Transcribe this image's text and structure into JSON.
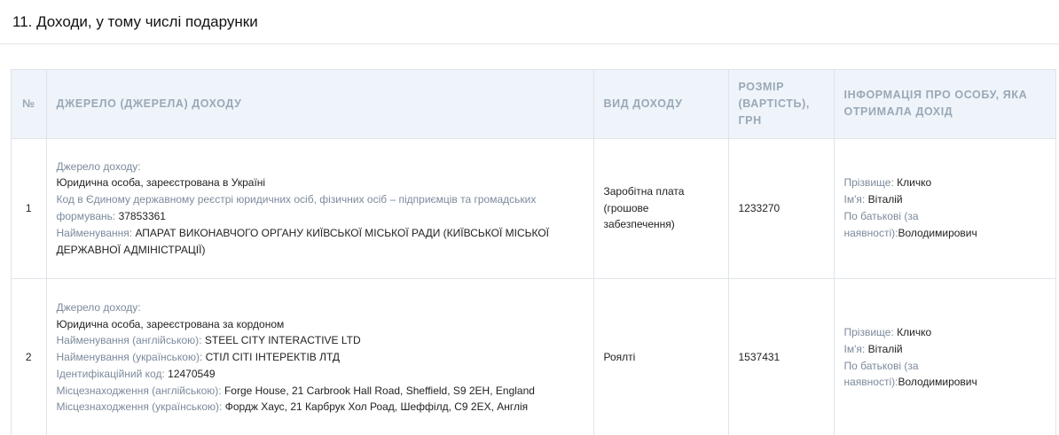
{
  "section": {
    "title": "11. Доходи, у тому числі подарунки"
  },
  "table": {
    "headers": {
      "num": "№",
      "source": "Джерело (джерела) доходу",
      "type": "Вид доходу",
      "amount": "Розмір (вартість), грн",
      "person": "Інформація про особу, яка отримала дохід"
    },
    "rows": [
      {
        "num": "1",
        "source": {
          "source_label": "Джерело доходу:",
          "source_value": "Юридична особа, зареєстрована в Україні",
          "code_label": "Код в Єдиному державному реєстрі юридичних осіб, фізичних осіб – підприємців та громадських формувань:",
          "code_value": "37853361",
          "name_label": "Найменування:",
          "name_value": "АПАРАТ ВИКОНАВЧОГО ОРГАНУ КИЇВСЬКОЇ МІСЬКОЇ РАДИ (КИЇВСЬКОЇ МІСЬКОЇ ДЕРЖАВНОЇ АДМІНІСТРАЦІЇ)"
        },
        "type": "Заробітна плата (грошове забезпечення)",
        "amount": "1233270",
        "person": {
          "surname_label": "Прізвище:",
          "surname_value": "Кличко",
          "name_label": "Ім'я:",
          "name_value": "Віталій",
          "patronymic_label": "По батькові (за наявності):",
          "patronymic_value": "Володимирович"
        }
      },
      {
        "num": "2",
        "source": {
          "source_label": "Джерело доходу:",
          "source_value": "Юридична особа, зареєстрована за кордоном",
          "name_en_label": "Найменування (англійською):",
          "name_en_value": "STEEL CITY INTERACTIVE LTD",
          "name_uk_label": "Найменування (українською):",
          "name_uk_value": "СТІЛ СІТІ ІНТЕРЕКТІВ ЛТД",
          "id_label": "Ідентифікаційний код:",
          "id_value": "12470549",
          "loc_en_label": "Місцезнаходження (англійською):",
          "loc_en_value": "Forge House, 21 Carbrook Hall Road, Sheffield, S9 2EH, England",
          "loc_uk_label": "Місцезнаходження (українською):",
          "loc_uk_value": "Фордж Хаус, 21 Карбрук Хол Роад, Шеффілд, С9 2ЕХ, Англія"
        },
        "type": "Роялті",
        "amount": "1537431",
        "person": {
          "surname_label": "Прізвище:",
          "surname_value": "Кличко",
          "name_label": "Ім'я:",
          "name_value": "Віталій",
          "patronymic_label": "По батькові (за наявності):",
          "patronymic_value": "Володимирович"
        }
      }
    ]
  }
}
